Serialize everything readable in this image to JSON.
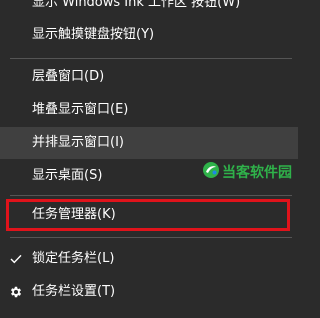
{
  "menu": {
    "items": [
      {
        "label": "显示 Windows Ink 工作区 按钮(W)"
      },
      {
        "label": "显示触摸键盘按钮(Y)"
      },
      {
        "label": "层叠窗口(D)"
      },
      {
        "label": "堆叠显示窗口(E)"
      },
      {
        "label": "并排显示窗口(I)"
      },
      {
        "label": "显示桌面(S)"
      },
      {
        "label": "任务管理器(K)"
      },
      {
        "label": "锁定任务栏(L)",
        "icon": "checkmark-icon"
      },
      {
        "label": "任务栏设置(T)",
        "icon": "gear-icon"
      }
    ]
  },
  "watermark": {
    "text": "当客软件园",
    "icon": "logo-icon"
  },
  "colors": {
    "menu_bg": "#2b2b2b",
    "hover_bg": "#404040",
    "separator": "#555555",
    "highlight_border": "#e0131b",
    "watermark_text": "#2fb24a"
  }
}
